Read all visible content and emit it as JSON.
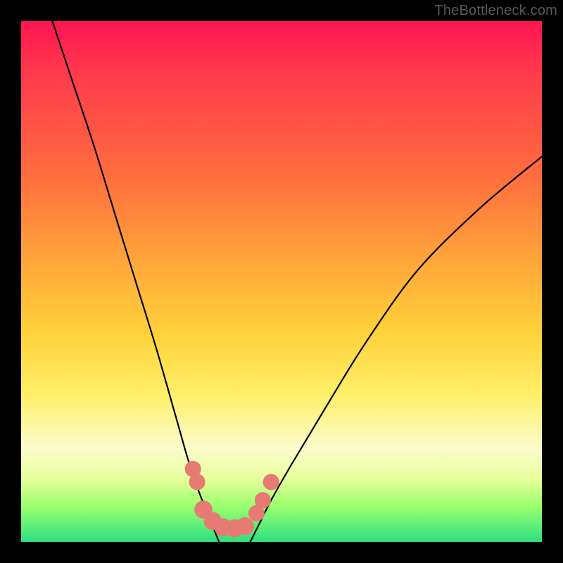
{
  "watermark": "TheBottleneck.com",
  "chart_data": {
    "type": "line",
    "title": "",
    "xlabel": "",
    "ylabel": "",
    "xlim": [
      0,
      100
    ],
    "ylim": [
      0,
      100
    ],
    "series": [
      {
        "name": "left-branch",
        "x": [
          6,
          10,
          14,
          18,
          22,
          26,
          30,
          32,
          34,
          36,
          38
        ],
        "y": [
          100,
          88,
          76,
          63,
          50,
          37,
          23,
          16,
          10,
          5,
          0
        ]
      },
      {
        "name": "right-branch",
        "x": [
          44,
          46,
          48,
          52,
          58,
          66,
          76,
          88,
          100
        ],
        "y": [
          0,
          4,
          8,
          15,
          25,
          38,
          52,
          64,
          74
        ]
      }
    ],
    "markers": [
      {
        "name": "left-dot-1",
        "x": 33.0,
        "y": 14.0,
        "r": 1.2
      },
      {
        "name": "left-dot-2",
        "x": 33.8,
        "y": 11.5,
        "r": 1.2
      },
      {
        "name": "valley-cap-1",
        "x": 35.0,
        "y": 6.2,
        "r": 1.4
      },
      {
        "name": "valley-cap-2",
        "x": 36.8,
        "y": 4.0,
        "r": 1.4
      },
      {
        "name": "valley-cap-3",
        "x": 38.8,
        "y": 2.8,
        "r": 1.4
      },
      {
        "name": "valley-cap-4",
        "x": 41.0,
        "y": 2.6,
        "r": 1.4
      },
      {
        "name": "valley-cap-5",
        "x": 43.0,
        "y": 3.0,
        "r": 1.4
      },
      {
        "name": "right-dot-1",
        "x": 45.2,
        "y": 5.5,
        "r": 1.2
      },
      {
        "name": "right-dot-2",
        "x": 46.4,
        "y": 8.0,
        "r": 1.2
      },
      {
        "name": "right-dot-3",
        "x": 48.0,
        "y": 11.5,
        "r": 1.2
      }
    ],
    "colors": {
      "curve": "#000000",
      "marker": "#e77a72"
    }
  }
}
